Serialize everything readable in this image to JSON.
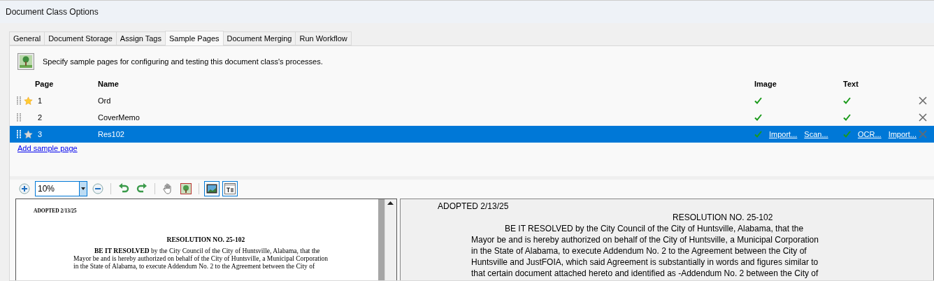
{
  "window": {
    "title": "Document Class Options"
  },
  "tabs": [
    {
      "label": "General",
      "selected": false
    },
    {
      "label": "Document Storage",
      "selected": false
    },
    {
      "label": "Assign Tags",
      "selected": false
    },
    {
      "label": "Sample Pages",
      "selected": true
    },
    {
      "label": "Document Merging",
      "selected": false
    },
    {
      "label": "Run Workflow",
      "selected": false
    }
  ],
  "description": "Specify sample pages for configuring and testing this document class's processes.",
  "table": {
    "columns": [
      "Page",
      "Name",
      "Image",
      "Text"
    ],
    "rows": [
      {
        "page": "1",
        "name": "Ord",
        "default": true,
        "selected": false,
        "image": {
          "ok": true
        },
        "text": {
          "ok": true
        }
      },
      {
        "page": "2",
        "name": "CoverMemo",
        "default": false,
        "selected": false,
        "image": {
          "ok": true
        },
        "text": {
          "ok": true
        }
      },
      {
        "page": "3",
        "name": "Res102",
        "default": false,
        "selected": true,
        "image": {
          "ok": true,
          "links": [
            "Import...",
            "Scan..."
          ]
        },
        "text": {
          "ok": true,
          "links": [
            "OCR...",
            "Import..."
          ]
        }
      }
    ]
  },
  "add_link": "Add sample page",
  "toolbar": {
    "zoom": "10%",
    "image_view_pressed": true,
    "text_view_pressed": true
  },
  "image_preview": {
    "date": "ADOPTED 2/13/25",
    "heading": "RESOLUTION NO. 25-102",
    "lines": [
      "**BE IT RESOLVED** by the City Council of the City of Huntsville, Alabama, that the",
      "Mayor be and is hereby authorized on behalf of the City of Huntsville, a Municipal Corporation",
      "in the State of Alabama, to execute Addendum No. 2 to the Agreement between the City of"
    ]
  },
  "text_preview": {
    "date": "ADOPTED 2/13/25",
    "heading": "RESOLUTION NO. 25-102",
    "lines": [
      "BE IT RESOLVED by the City Council of the City of Huntsville, Alabama, that the",
      "Mayor be and is hereby authorized on behalf of the City of Huntsville, a Municipal Corporation",
      "in the State of Alabama, to execute Addendum No. 2 to the Agreement between the City of",
      "Huntsville and JustFOIA, which said Agreement is substantially in words and figures similar to",
      "that certain document attached hereto and identified as -Addendum No. 2 between the City of"
    ]
  }
}
